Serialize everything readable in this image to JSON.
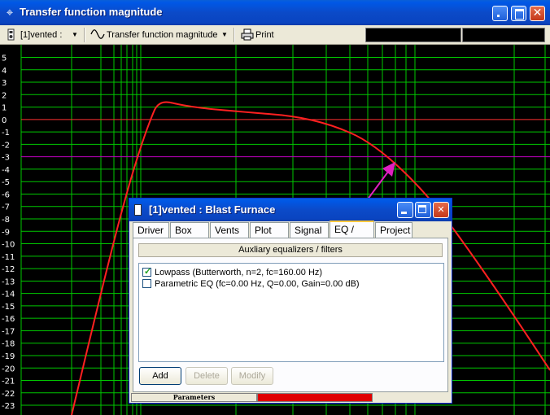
{
  "window": {
    "title": "Transfer function magnitude",
    "icon": "crosshair-icon",
    "caption_buttons": [
      "minimize",
      "maximize",
      "close"
    ]
  },
  "toolbar": {
    "project_select": "[1]vented :",
    "view_select": "Transfer function magnitude",
    "print_label": "Print",
    "icons": [
      "project-icon",
      "sine-wave-icon",
      "printer-icon"
    ]
  },
  "plot": {
    "y_ticks": [
      "5",
      "4",
      "3",
      "2",
      "1",
      "0",
      "-1",
      "-2",
      "-3",
      "-4",
      "-5",
      "-6",
      "-7",
      "-8",
      "-9",
      "-10",
      "-11",
      "-12",
      "-13",
      "-14",
      "-15",
      "-16",
      "-17",
      "-18",
      "-19",
      "-20",
      "-21",
      "-22",
      "-23"
    ],
    "colors": {
      "background": "#000000",
      "grid": "#00c800",
      "curve": "#ff2020",
      "zero_line": "#ff3030",
      "ref_line": "#c000c0",
      "arrow": "#e020c0"
    }
  },
  "dialog": {
    "title": "[1]vented : Blast Furnace",
    "tabs": [
      "Driver",
      "Box",
      "Vents",
      "Plot",
      "Signal",
      "EQ / Filter",
      "Project"
    ],
    "active_tab": "EQ / Filter",
    "section_header": "Auxliary equalizers / filters",
    "filters": [
      {
        "label": "Lowpass (Butterworth, n=2, fc=160.00 Hz)",
        "checked": true
      },
      {
        "label": "Parametric EQ (fc=0.00 Hz, Q=0.00, Gain=0.00 dB)",
        "checked": false
      }
    ],
    "buttons": {
      "add": "Add",
      "delete": "Delete",
      "modify": "Modify"
    },
    "status_label": "Parameters",
    "progress_fraction": 0.6
  }
}
